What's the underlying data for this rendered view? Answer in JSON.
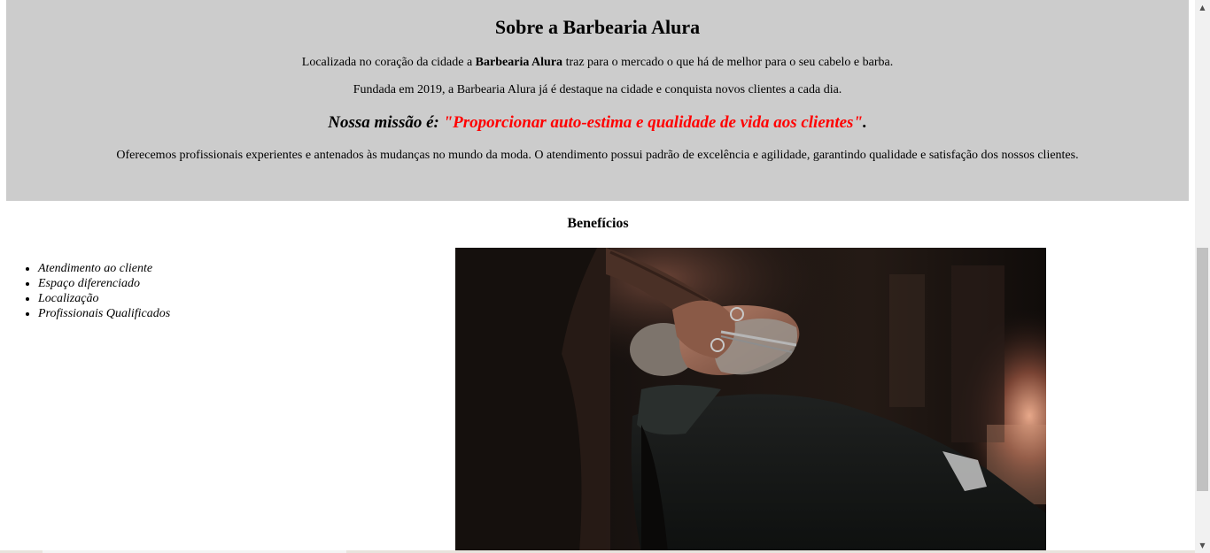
{
  "about": {
    "title": "Sobre a Barbearia Alura",
    "p1_before": "Localizada no coração da cidade a ",
    "p1_bold": "Barbearia Alura",
    "p1_after": " traz para o mercado o que há de melhor para o seu cabelo e barba.",
    "p2": "Fundada em 2019, a Barbearia Alura já é destaque na cidade e conquista novos clientes a cada dia.",
    "mission_label": "Nossa missão é: ",
    "mission_quote": "\"Proporcionar auto-estima e qualidade de vida aos clientes\"",
    "mission_end": ".",
    "p3": "Oferecemos profissionais experientes e antenados às mudanças no mundo da moda. O atendimento possui padrão de excelência e agilidade, garantindo qualidade e satisfação dos nossos clientes."
  },
  "benefits": {
    "title": "Benefícios",
    "items": [
      "Atendimento ao cliente",
      "Espaço diferenciado",
      "Localização",
      "Profissionais Qualificados"
    ]
  },
  "colors": {
    "about_bg": "#cccccc",
    "mission_highlight": "#ff0000"
  }
}
